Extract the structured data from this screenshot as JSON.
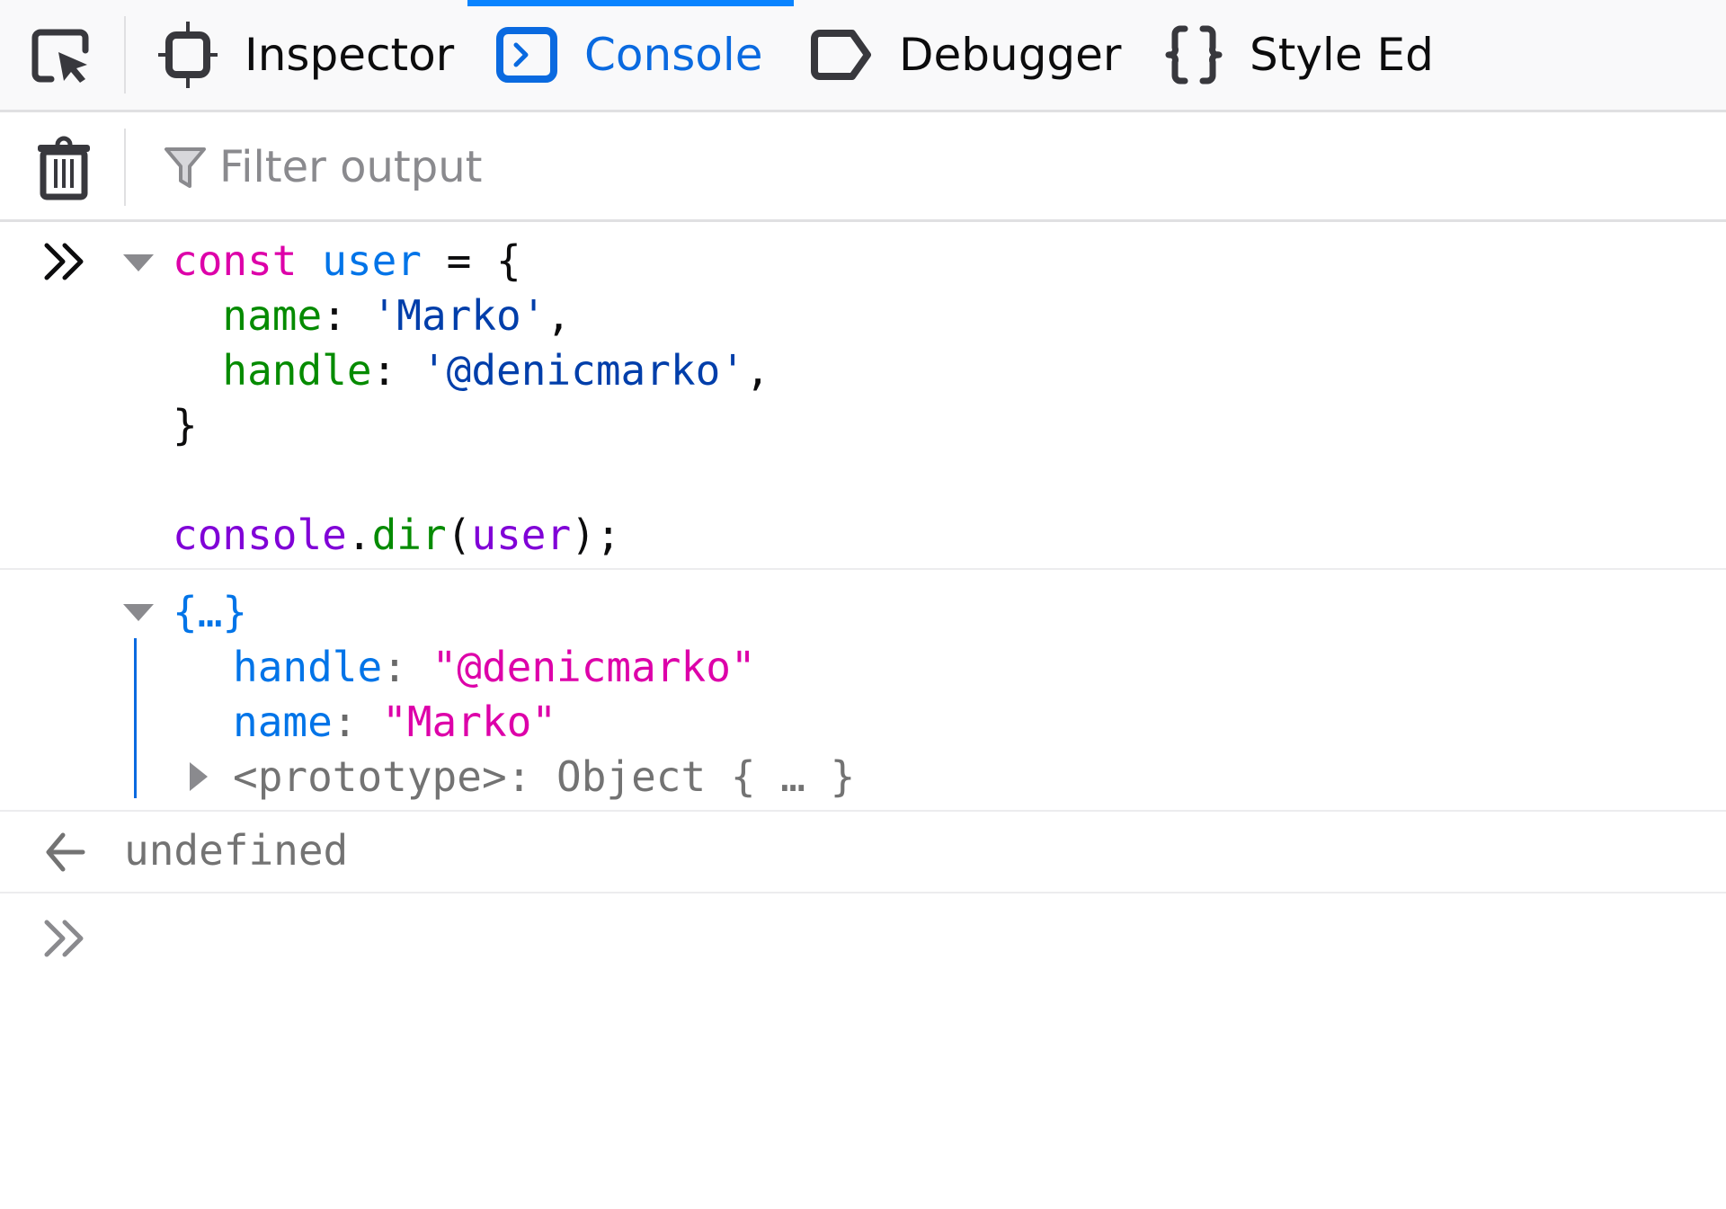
{
  "tabs": {
    "picker": {
      "icon": "element-picker-icon"
    },
    "items": [
      {
        "label": "Inspector",
        "icon": "inspector-icon",
        "active": false
      },
      {
        "label": "Console",
        "icon": "console-icon",
        "active": true
      },
      {
        "label": "Debugger",
        "icon": "debugger-icon",
        "active": false
      },
      {
        "label": "Style Ed",
        "icon": "style-editor-icon",
        "active": false
      }
    ]
  },
  "toolbar": {
    "clear_icon": "trash-icon",
    "filter_icon": "funnel-icon",
    "filter_placeholder": "Filter output",
    "filter_value": ""
  },
  "colors": {
    "accent": "#0a84ff",
    "active_tab_text": "#0a6ae0",
    "keyword": "#dd00a9",
    "variable": "#0074e8",
    "property": "#058b00",
    "string_input": "#003eaa",
    "string_output": "#dd00a9",
    "muted": "#737373"
  },
  "console": {
    "input": {
      "prompt_icon": "double-chevron-right-icon",
      "lines": {
        "l1": {
          "kw": "const",
          "var": "user",
          "rest": " = {"
        },
        "l2": {
          "indent": "  ",
          "prop": "name",
          "colon": ": ",
          "str": "'Marko'",
          "end": ","
        },
        "l3": {
          "indent": "  ",
          "prop": "handle",
          "colon": ": ",
          "str": "'@denicmarko'",
          "end": ","
        },
        "l4": {
          "text": "}"
        },
        "l6": {
          "obj": "console",
          "dot": ".",
          "method": "dir",
          "open": "(",
          "arg": "user",
          "close": ");"
        }
      }
    },
    "output": {
      "summary": "{…}",
      "props": [
        {
          "key": "handle",
          "sep": ": ",
          "value": "\"@denicmarko\""
        },
        {
          "key": "name",
          "sep": ": ",
          "value": "\"Marko\""
        }
      ],
      "prototype": {
        "key": "<prototype>",
        "sep": ": ",
        "value": "Object { … }"
      }
    },
    "result": {
      "icon": "return-arrow-icon",
      "text": "undefined"
    },
    "prompt": {
      "icon": "double-chevron-right-icon",
      "value": ""
    }
  }
}
